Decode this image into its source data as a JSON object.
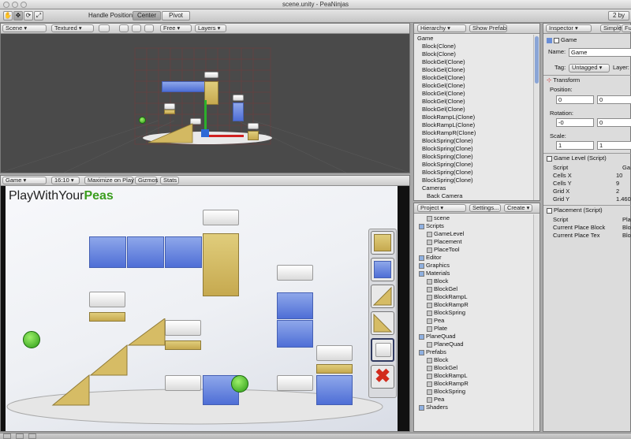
{
  "window": {
    "title": "scene.unity - PeaNinjas"
  },
  "toolbar": {
    "handle_label": "Handle Position:",
    "center": "Center",
    "pivot": "Pivot",
    "layers": "2 by"
  },
  "scene": {
    "tab": "Scene",
    "mode": "Textured",
    "free": "Free",
    "layers": "Layers"
  },
  "game": {
    "tab": "Game",
    "aspect": "16:10",
    "maximize": "Maximize on Play",
    "gizmos": "Gizmos",
    "stats": "Stats",
    "logo_a": "PlayWithYour",
    "logo_b": "Peas"
  },
  "hierarchy": {
    "tab": "Hierarchy",
    "show_prefab": "Show Prefab",
    "items": [
      "Game",
      "Block(Clone)",
      "Block(Clone)",
      "BlockGel(Clone)",
      "BlockGel(Clone)",
      "BlockGel(Clone)",
      "BlockGel(Clone)",
      "BlockGel(Clone)",
      "BlockGel(Clone)",
      "BlockGel(Clone)",
      "BlockRampL(Clone)",
      "BlockRampL(Clone)",
      "BlockRampR(Clone)",
      "BlockSpring(Clone)",
      "BlockSpring(Clone)",
      "BlockSpring(Clone)",
      "BlockSpring(Clone)",
      "BlockSpring(Clone)",
      "BlockSpring(Clone)",
      "Cameras",
      "Back Camera"
    ]
  },
  "project": {
    "tab": "Project",
    "settings": "Settings...",
    "create": "Create",
    "items": [
      "scene",
      "Scripts",
      "GameLevel",
      "Placement",
      "PlaceTool",
      "Editor",
      "Graphics",
      "Materials",
      "Block",
      "BlockGel",
      "BlockRampL",
      "BlockRampR",
      "BlockSpring",
      "Pea",
      "Plate",
      "PlaneQuad",
      "PlaneQuad",
      "Prefabs",
      "Block",
      "BlockGel",
      "BlockRampL",
      "BlockRampR",
      "BlockSpring",
      "Pea",
      "Shaders"
    ]
  },
  "inspector": {
    "tab": "Inspector",
    "simple": "Simple",
    "ful": "Fu",
    "obj_name": "Game",
    "name_lbl": "Name:",
    "name_val": "Game",
    "tag_lbl": "Tag:",
    "tag_val": "Untagged",
    "layer_lbl": "Layer:",
    "transform": "Transform",
    "position": "Position:",
    "pos_x": "0",
    "pos_y": "0",
    "rotation": "Rotation:",
    "rot_x": "-0",
    "rot_y": "0",
    "scale": "Scale:",
    "scl_x": "1",
    "scl_y": "1",
    "gamelevel": "Game Level (Script)",
    "script": "Script",
    "gl_script": "Ga",
    "cells_x": "Cells X",
    "cells_x_v": "10",
    "cells_y": "Cells Y",
    "cells_y_v": "9",
    "grid_x": "Grid X",
    "grid_x_v": "2",
    "grid_y": "Grid Y",
    "grid_y_v": "1.460",
    "placement": "Placement (Script)",
    "pl_script": "Pla",
    "cpb": "Current Place Block",
    "cpb_v": "Blo",
    "cpt": "Current Place Tex",
    "cpt_v": "Blo"
  },
  "colors": {
    "logo_green": "#3a9d1e",
    "remove_red": "#d22b1c"
  }
}
